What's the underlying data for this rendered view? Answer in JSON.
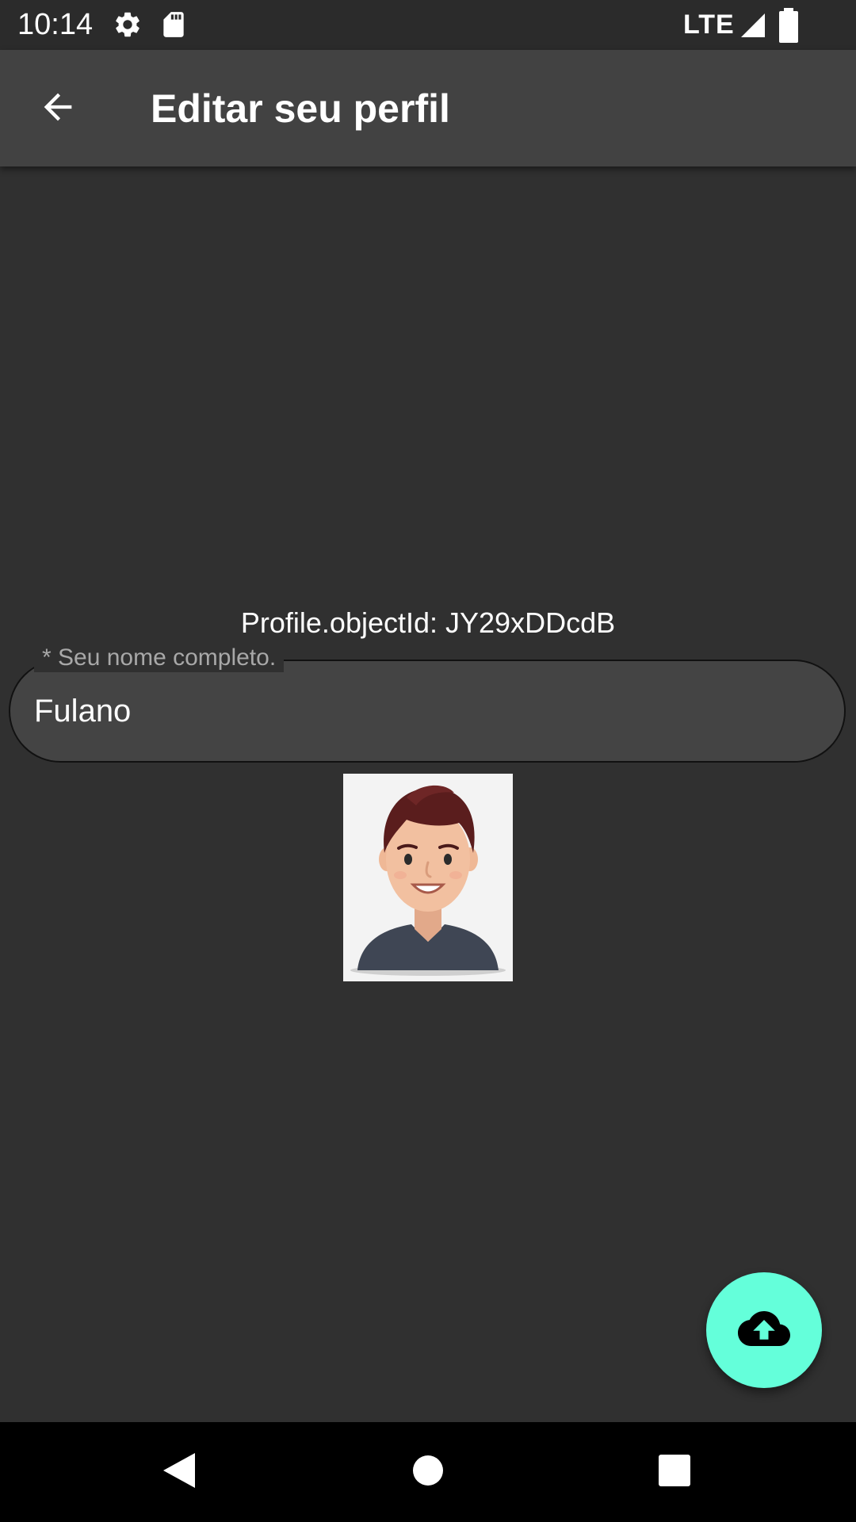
{
  "status_bar": {
    "time": "10:14",
    "network": "LTE",
    "icons": [
      "settings-icon",
      "sd-card-icon",
      "signal-icon",
      "battery-icon"
    ]
  },
  "app_bar": {
    "title": "Editar seu perfil",
    "back_icon": "arrow-back-icon"
  },
  "profile": {
    "object_id_text": "Profile.objectId: JY29xDDcdB",
    "name_field": {
      "label": "* Seu nome completo.",
      "value": "Fulano"
    },
    "avatar": "male-avatar-illustration"
  },
  "fab": {
    "icon": "cloud-upload-icon",
    "color": "#64ffda"
  },
  "nav_bar": {
    "icons": [
      "nav-back-icon",
      "nav-home-icon",
      "nav-recents-icon"
    ]
  },
  "colors": {
    "background": "#303030",
    "app_bar": "#424242",
    "status_bar": "#2b2b2b",
    "accent": "#64ffda"
  }
}
